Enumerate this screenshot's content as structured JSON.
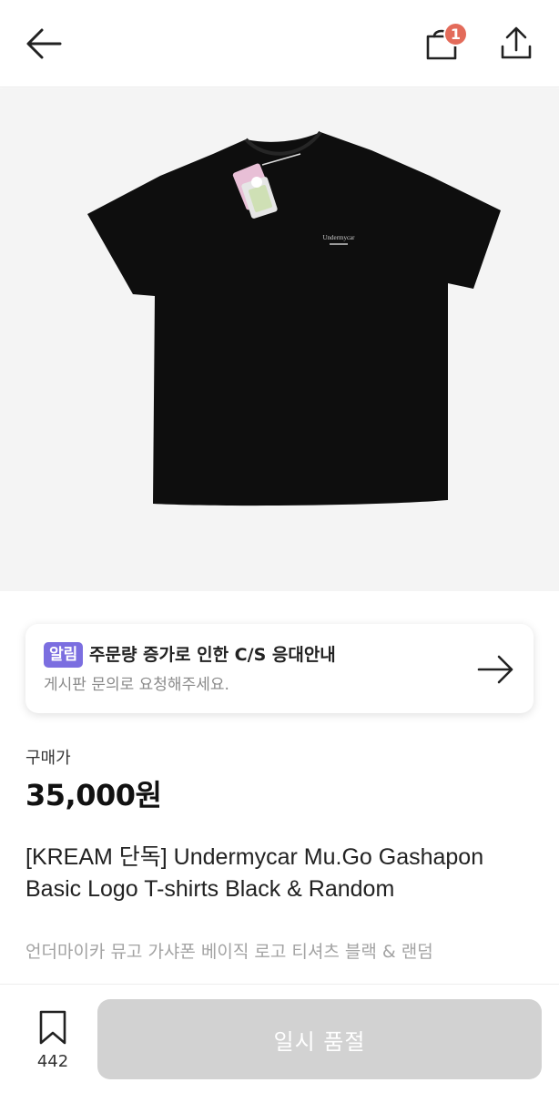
{
  "header": {
    "cart_badge_count": "1",
    "icons": [
      "arrow-left-icon",
      "shopping-bag-icon",
      "share-icon"
    ]
  },
  "product_image": {
    "logo_text": "Undermycar",
    "colors": {
      "background": "#f4f4f4",
      "shirt": "#0e0e0e"
    }
  },
  "notice": {
    "tag": "알림",
    "title": "주문량 증가로 인한 C/S 응대안내",
    "subtitle": "게시판 문의로 요청해주세요.",
    "accent_color": "#7b6ee0"
  },
  "price": {
    "label": "구매가",
    "value": "35,000원"
  },
  "product": {
    "title": "[KREAM 단독] Undermycar Mu.Go Gashapon Basic Logo T-shirts Black & Random",
    "subtitle": "언더마이카 뮤고 가샤폰 베이직 로고 티셔츠 블랙 & 랜덤"
  },
  "bottom_bar": {
    "wish_count": "442",
    "soldout_label": "일시 품절"
  }
}
